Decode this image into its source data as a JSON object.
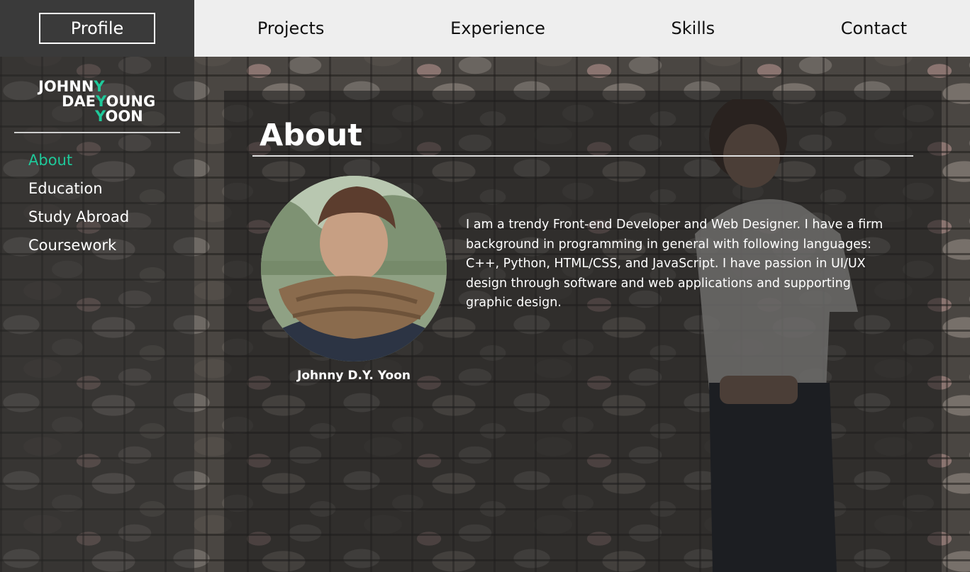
{
  "nav": {
    "profile": "Profile",
    "links": [
      "Projects",
      "Experience",
      "Skills",
      "Contact"
    ]
  },
  "logo": {
    "line1": "JOHNN",
    "line1_acc": "Y",
    "line2a": "DAE",
    "line2_acc": "Y",
    "line2b": "OUNG",
    "line3_acc": "Y",
    "line3b": "OON"
  },
  "sidebar": {
    "items": [
      {
        "label": "About",
        "active": true
      },
      {
        "label": "Education",
        "active": false
      },
      {
        "label": "Study Abroad",
        "active": false
      },
      {
        "label": "Coursework",
        "active": false
      }
    ]
  },
  "main": {
    "title": "About",
    "avatar_caption": "Johnny D.Y. Yoon",
    "about_text": "I am a trendy Front-end Developer and Web Designer. I have a firm background in programming in general with following languages: C++, Python, HTML/CSS, and JavaScript. I have passion in UI/UX design through software and web applications and supporting graphic design."
  },
  "colors": {
    "accent": "#1fc99a",
    "nav_bg": "#eeeeee",
    "brand_bg": "#3a3a3a"
  }
}
